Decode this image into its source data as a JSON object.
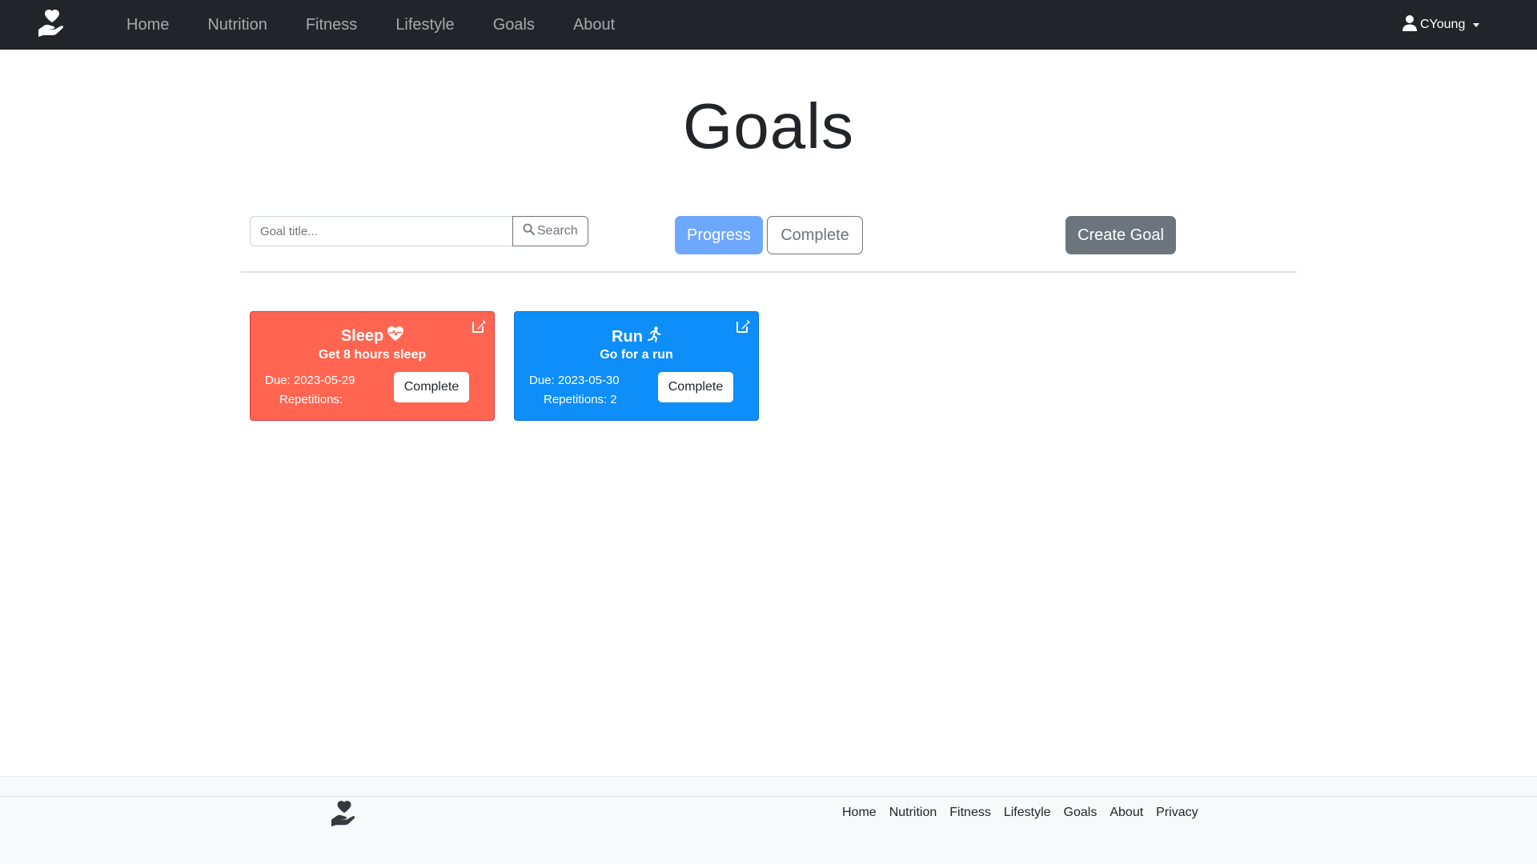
{
  "nav": {
    "links": [
      "Home",
      "Nutrition",
      "Fitness",
      "Lifestyle",
      "Goals",
      "About"
    ],
    "user": "CYoung"
  },
  "page": {
    "title": "Goals"
  },
  "toolbar": {
    "search_placeholder": "Goal title...",
    "search_label": "Search",
    "progress_label": "Progress",
    "complete_label": "Complete",
    "create_label": "Create Goal"
  },
  "goals": [
    {
      "title": "Sleep",
      "icon": "heart-pulse-icon",
      "description": "Get 8 hours sleep",
      "due_label": "Due:",
      "due": "2023-05-29",
      "repetitions_label": "Repetitions:",
      "repetitions": "",
      "action_label": "Complete",
      "color": "#ff6550"
    },
    {
      "title": "Run",
      "icon": "person-running-icon",
      "description": "Go for a run",
      "due_label": "Due:",
      "due": "2023-05-30",
      "repetitions_label": "Repetitions:",
      "repetitions": "2",
      "action_label": "Complete",
      "color": "#0d8ef8"
    }
  ],
  "footer": {
    "links": [
      "Home",
      "Nutrition",
      "Fitness",
      "Lifestyle",
      "Goals",
      "About",
      "Privacy"
    ]
  },
  "colors": {
    "navbar": "#212529",
    "primary_light": "#6ea8fe",
    "secondary": "#6c757d",
    "footer_bg": "#f8f9fa"
  }
}
